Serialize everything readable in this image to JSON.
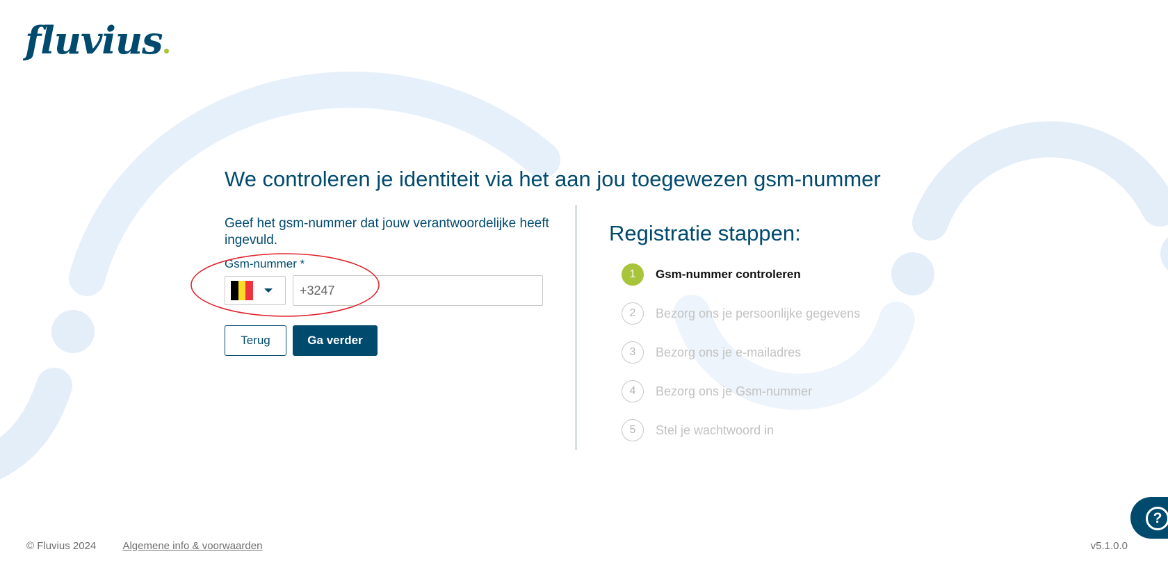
{
  "brand": {
    "logo_text": "fluvius",
    "primary_color": "#004a6e",
    "accent_color": "#a8c43a"
  },
  "page": {
    "title": "We controleren je identiteit via het aan jou toegewezen gsm-nummer"
  },
  "form": {
    "instruction": "Geef het gsm-nummer dat jouw verantwoordelijke heeft ingevuld.",
    "phone_label": "Gsm-nummer *",
    "country_icon": "belgium-flag-icon",
    "phone_placeholder": "+3247",
    "back_label": "Terug",
    "next_label": "Ga verder"
  },
  "steps": {
    "title": "Registratie stappen:",
    "active_index": 0,
    "items": [
      {
        "number": "1",
        "label": "Gsm-nummer controleren"
      },
      {
        "number": "2",
        "label": "Bezorg ons je persoonlijke gegevens"
      },
      {
        "number": "3",
        "label": "Bezorg ons je e-mailadres"
      },
      {
        "number": "4",
        "label": "Bezorg ons je Gsm-nummer"
      },
      {
        "number": "5",
        "label": "Stel je wachtwoord in"
      }
    ]
  },
  "footer": {
    "copyright": "© Fluvius 2024",
    "terms_link": "Algemene info & voorwaarden",
    "version": "v5.1.0.0"
  },
  "help": {
    "icon": "help-icon",
    "glyph": "?"
  }
}
